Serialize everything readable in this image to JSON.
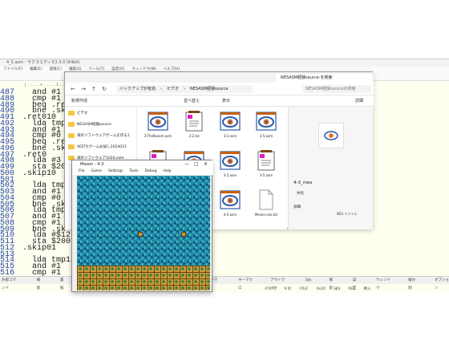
{
  "editor": {
    "title": "4_5.asm - サクラエディタ2.3.0 (64bit)",
    "menu": [
      "ファイル(F)",
      "編集(E)",
      "変換(C)",
      "検索(S)",
      "ツール(T)",
      "設定(O)",
      "ウィンドウ(W)",
      "ヘルプ(H)"
    ],
    "ruler": "|....+....1....+....2....+....3",
    "lines": [
      {
        "num": "487",
        "text": "  and #1"
      },
      {
        "num": "488",
        "text": "  cmp #1"
      },
      {
        "num": "489",
        "text": "  beq .re"
      },
      {
        "num": "490",
        "text": "  bne .sk"
      },
      {
        "num": "491",
        "text": ".ret010"
      },
      {
        "num": "492",
        "text": "  lda tmp"
      },
      {
        "num": "493",
        "text": "  and #1"
      },
      {
        "num": "494",
        "text": "  cmp #0"
      },
      {
        "num": "495",
        "text": "  beq .re"
      },
      {
        "num": "496",
        "text": "  bne .sk"
      },
      {
        "num": "497",
        "text": ".ret0"
      },
      {
        "num": "498",
        "text": "  lda #3"
      },
      {
        "num": "499",
        "text": "  sta $20"
      },
      {
        "num": "500",
        "text": ".skip10"
      },
      {
        "num": "501",
        "text": ""
      },
      {
        "num": "502",
        "text": "  lda tmp"
      },
      {
        "num": "503",
        "text": "  and #1"
      },
      {
        "num": "504",
        "text": "  cmp #0"
      },
      {
        "num": "505",
        "text": "  bne .sk"
      },
      {
        "num": "506",
        "text": "  lda tmp"
      },
      {
        "num": "507",
        "text": "  and #1"
      },
      {
        "num": "508",
        "text": "  cmp #1"
      },
      {
        "num": "509",
        "text": "  bne .sk"
      },
      {
        "num": "510",
        "text": "  lda #$12"
      },
      {
        "num": "511",
        "text": "  sta $2007"
      },
      {
        "num": "512",
        "text": ".skip01"
      },
      {
        "num": "513",
        "text": ""
      },
      {
        "num": "514",
        "text": "  lda tmp1"
      },
      {
        "num": "515",
        "text": "  and #1"
      },
      {
        "num": "516",
        "text": "  cmp #1"
      }
    ],
    "status": [
      "外部コマンド",
      "検索",
      "置換",
      "次を検索",
      "前を検索",
      "Grep",
      "タグジャンプ",
      "ブックマーク",
      "キーマクロ",
      "アウトライン",
      "Sjis",
      "検索",
      "設定",
      "ウィンドウ",
      "縦分割",
      "オプション"
    ],
    "status2": [
      "476 行",
      "9 桁",
      "CRLF",
      "0x20",
      "SJIS",
      "REC",
      "挿入"
    ]
  },
  "explorer": {
    "tab_title": "NESASM経験source-を検索",
    "breadcrumb": [
      "バックアップが有効",
      "ビデオ",
      "NESASM経験source"
    ],
    "search_placeholder": "NESASM経験sourceの検索",
    "new_label": "新規作成",
    "sort_label": "並べ替え",
    "view_label": "表示",
    "details_label": "詳細",
    "nav_items": [
      "ビデオ",
      "NESASM経験source",
      "海外ソフトウェアゲームを作る1",
      "AE打ちゲームお試し2024021",
      "海外ソフトウェア1024.com"
    ],
    "files": [
      {
        "name": "3-TheRoosm.asm",
        "kind": "asm"
      },
      {
        "name": "3-2.txt",
        "kind": "txt"
      },
      {
        "name": "3-2.asm",
        "kind": "asm"
      },
      {
        "name": "3-5.asm",
        "kind": "asm"
      },
      {
        "name": "3-2.asm",
        "kind": "txt"
      },
      {
        "name": "3-3.asm",
        "kind": "asm"
      },
      {
        "name": "3-5.asm",
        "kind": "asm"
      },
      {
        "name": "3-5.asm",
        "kind": "txt"
      },
      {
        "name": "4-5.asm",
        "kind": "asm"
      },
      {
        "name": "4-3.asm",
        "kind": "asm"
      },
      {
        "name": "4-5.asm",
        "kind": "asm"
      },
      {
        "name": "Mesen.nes.txt",
        "kind": "blank"
      }
    ],
    "preview": {
      "file": "4-3_mes",
      "share_label": "共有",
      "section_label": "詳細",
      "type_label": "NES ファイル"
    }
  },
  "emulator": {
    "title": "Mesen - 4-3",
    "menu": [
      "File",
      "Game",
      "Settings",
      "Tools",
      "Debug",
      "Help"
    ]
  },
  "colors": {
    "sea": "#1f8aa6",
    "ground": "#c89a3c",
    "linenum": "#2244aa"
  }
}
